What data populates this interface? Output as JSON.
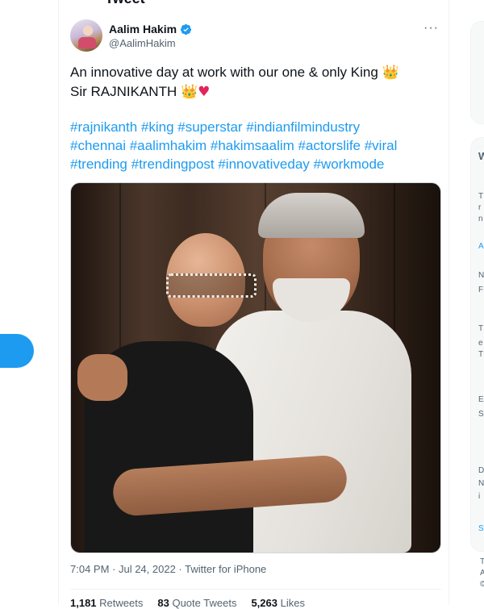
{
  "header": {
    "partial_title": "Tweet"
  },
  "tweet": {
    "author": {
      "display_name": "Aalim Hakim",
      "handle": "@AalimHakim",
      "verified": true
    },
    "more_label": "···",
    "text_line1": "An innovative day at work with our one & only King ",
    "text_line2": "Sir RAJNIKANTH ",
    "emoji_crown": "👑",
    "emoji_heart": "♥",
    "hashtags": [
      "#rajnikanth #king #superstar #indianfilmindustry",
      "#chennai #aalimhakim #hakimsaalim #actorslife #viral",
      "#trending #trendingpost #innovativeday #workmode"
    ],
    "timestamp": "7:04 PM · Jul 24, 2022 · ",
    "source": "Twitter for iPhone",
    "stats": {
      "retweets_count": "1,181",
      "retweets_label": "Retweets",
      "quotes_count": "83",
      "quotes_label": "Quote Tweets",
      "likes_count": "5,263",
      "likes_label": "Likes"
    }
  },
  "right_pane": {
    "letters": [
      "W",
      "T",
      "r",
      "n",
      "A",
      "N",
      "F",
      "",
      "T",
      "e",
      "T",
      "",
      "E",
      "S",
      "",
      "D",
      "N",
      "i",
      "S"
    ],
    "footer_lines": [
      "T",
      "A",
      "©"
    ]
  },
  "colors": {
    "accent": "#1d9bf0",
    "text": "#0f1419",
    "muted": "#536471"
  }
}
